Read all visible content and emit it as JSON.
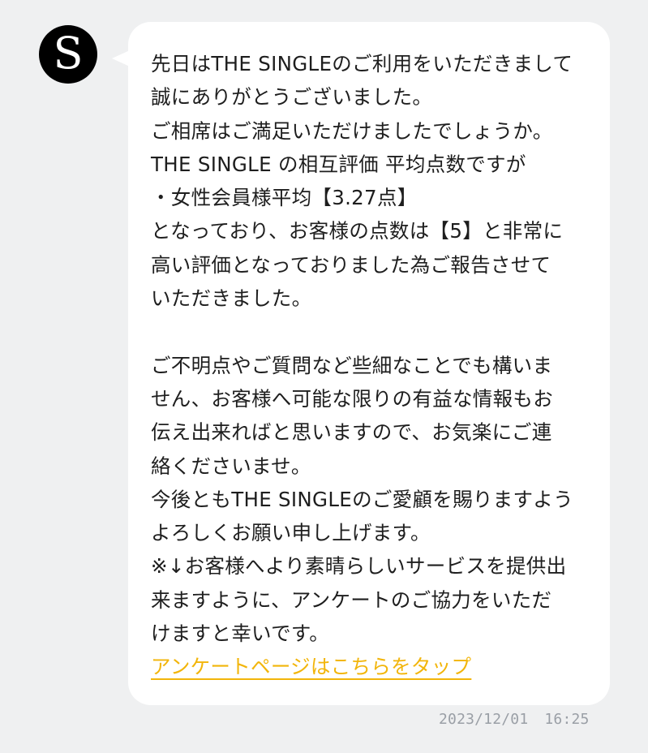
{
  "sender": {
    "avatar_letter": "S",
    "avatar_color": "#000000"
  },
  "message": {
    "lines": [
      "先日はTHE SINGLEのご利用をいただきまして",
      "誠にありがとうございました。",
      "ご相席はご満足いただけましたでしょうか。",
      "THE SINGLE の相互評価 平均点数ですが",
      "・女性会員様平均【3.27点】",
      "となっており、お客様の点数は【5】と非常に",
      "高い評価となっておりました為ご報告させて",
      "いただきました。",
      "",
      "ご不明点やご質問など些細なことでも構いま",
      "せん、お客様へ可能な限りの有益な情報もお",
      "伝え出来ればと思いますので、お気楽にご連",
      "絡くださいませ。",
      "今後ともTHE SINGLEのご愛顧を賜りますよう",
      "よろしくお願い申し上げます。",
      "※↓お客様へより素晴らしいサービスを提供出",
      "来ますように、アンケートのご協力をいただ",
      "けますと幸いです。"
    ],
    "link_text": "アンケートページはこちらをタップ",
    "link_color": "#f2b50a"
  },
  "timestamp": {
    "date": "2023/12/01",
    "time": "16:25"
  },
  "colors": {
    "background": "#eff0f1",
    "bubble": "#ffffff",
    "text": "#1e1e1e",
    "timestamp": "#9a9fa6"
  }
}
